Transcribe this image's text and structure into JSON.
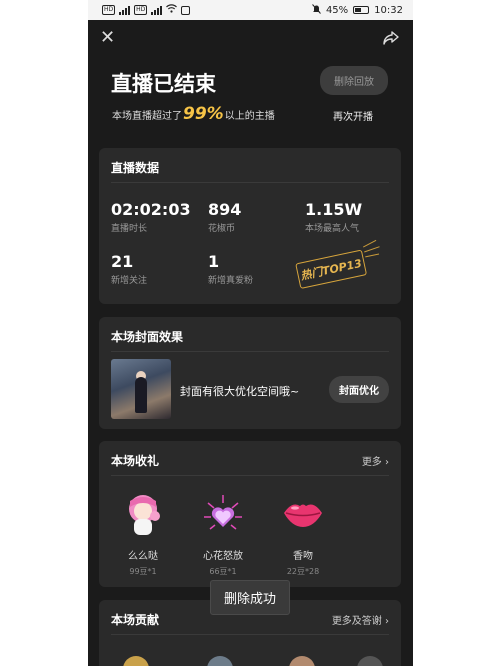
{
  "statusbar": {
    "battery": "45%",
    "time": "10:32",
    "net_speed": "HD"
  },
  "header": {
    "title": "直播已结束",
    "sub_prefix": "本场直播超过了",
    "sub_pct": "99%",
    "sub_suffix": "以上的主播",
    "delete_label": "删除回放",
    "reopen_label": "再次开播"
  },
  "live_data": {
    "title": "直播数据",
    "stats": [
      {
        "value": "02:02:03",
        "label": "直播时长"
      },
      {
        "value": "894",
        "label": "花椒币"
      },
      {
        "value": "1.15W",
        "label": "本场最高人气"
      },
      {
        "value": "21",
        "label": "新增关注"
      },
      {
        "value": "1",
        "label": "新增真爱粉"
      }
    ],
    "badge": "热门TOP13"
  },
  "cover": {
    "title": "本场封面效果",
    "text": "封面有很大优化空间哦~",
    "button": "封面优化"
  },
  "gifts": {
    "title": "本场收礼",
    "more": "更多",
    "items": [
      {
        "name": "么么哒",
        "count": "99豆*1"
      },
      {
        "name": "心花怒放",
        "count": "66豆*1"
      },
      {
        "name": "香吻",
        "count": "22豆*28"
      }
    ]
  },
  "contrib": {
    "title": "本场贡献",
    "more": "更多及答谢"
  },
  "toast": "删除成功",
  "colors": {
    "accent": "#f7c447",
    "bg": "#1b1b1b",
    "card": "#2a2a2a"
  }
}
